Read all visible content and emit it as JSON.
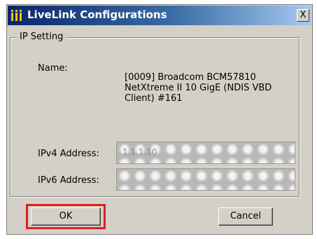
{
  "window": {
    "title": "LiveLink Configurations",
    "title_icon": "livelink-bars-icon",
    "close_label": "X"
  },
  "ip_setting": {
    "group_label": "IP Setting",
    "name_label": "Name:",
    "name_value_lines": [
      "[0009] Broadcom BCM57810",
      "NetXtreme II 10 GigE (NDIS VBD",
      "Client) #161"
    ],
    "ipv4_label": "IPv4 Address:",
    "ipv4_value": "1.1.1.10",
    "ipv6_label": "IPv6 Address:",
    "ipv6_value": ""
  },
  "buttons": {
    "ok_label": "OK",
    "cancel_label": "Cancel"
  },
  "colors": {
    "highlight": "#e0201e",
    "titlebar_start": "#0a246a",
    "titlebar_end": "#a6caf0",
    "dialog_bg": "#d4d0c8"
  }
}
